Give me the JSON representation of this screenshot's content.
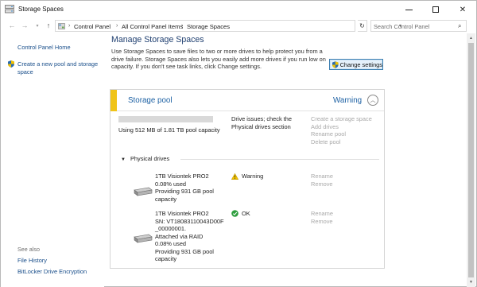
{
  "window": {
    "title": "Storage Spaces"
  },
  "address": {
    "crumbs": [
      "Control Panel",
      "All Control Panel Items",
      "Storage Spaces"
    ]
  },
  "search": {
    "placeholder": "Search Control Panel"
  },
  "sidebar": {
    "home": "Control Panel Home",
    "create_pool": "Create a new pool and storage space",
    "see_also": "See also",
    "links": [
      "File History",
      "BitLocker Drive Encryption"
    ]
  },
  "main": {
    "title": "Manage Storage Spaces",
    "description": "Use Storage Spaces to save files to two or more drives to help protect you from a drive failure. Storage Spaces also lets you easily add more drives if you run low on capacity. If you don't see task links, click Change settings.",
    "change_settings": "Change settings"
  },
  "pool": {
    "title": "Storage pool",
    "status": "Warning",
    "capacity_text": "Using 512 MB of 1.81 TB pool capacity",
    "capacity_fraction": 0.0003,
    "issues_text": "Drive issues; check the Physical drives section",
    "tasks": [
      "Create a storage space",
      "Add drives",
      "Rename pool",
      "Delete pool"
    ],
    "physical_drives_label": "Physical drives"
  },
  "drives": [
    {
      "info": [
        "1TB Visiontek PRO2",
        "0.08% used",
        "Providing 931 GB pool",
        "capacity"
      ],
      "status": "Warning",
      "status_icon": "warning-icon",
      "actions": [
        "Rename",
        "Remove"
      ]
    },
    {
      "info": [
        "1TB Visiontek PRO2",
        "SN: VT18083110043D00F",
        "_00000001.",
        "Attached via RAID",
        "0.08% used",
        "Providing 931 GB pool",
        "capacity"
      ],
      "status": "OK",
      "status_icon": "ok-check-icon",
      "actions": [
        "Rename",
        "Remove"
      ]
    }
  ],
  "colors": {
    "accent_yellow": "#f0c419",
    "link_blue": "#1c60a3",
    "capacity_blue": "#3f8fd2"
  }
}
